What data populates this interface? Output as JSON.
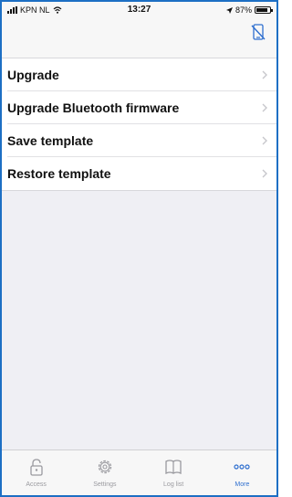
{
  "status_bar": {
    "carrier": "KPN NL",
    "time": "13:27",
    "battery": "87%",
    "battery_level": 0.87
  },
  "menu": {
    "items": [
      {
        "label": "Upgrade"
      },
      {
        "label": "Upgrade Bluetooth firmware"
      },
      {
        "label": "Save template"
      },
      {
        "label": "Restore template"
      }
    ]
  },
  "tab_bar": {
    "tabs": [
      {
        "label": "Access",
        "icon": "lock-icon"
      },
      {
        "label": "Settings",
        "icon": "gear-icon"
      },
      {
        "label": "Log list",
        "icon": "book-icon"
      },
      {
        "label": "More",
        "icon": "more-icon",
        "active": true
      }
    ]
  },
  "colors": {
    "accent": "#2f6fcf",
    "inactive": "#9a9a9f",
    "background": "#efeff4"
  }
}
